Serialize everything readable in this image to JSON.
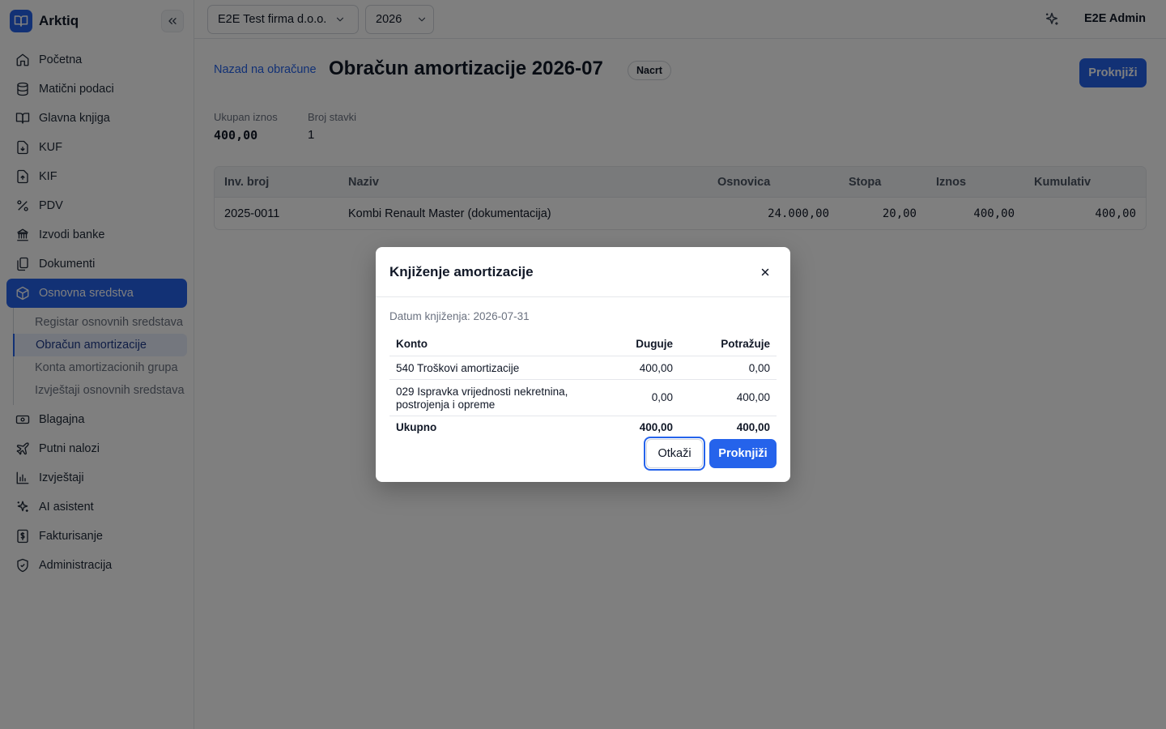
{
  "app": {
    "name": "Arktiq"
  },
  "sidebar": {
    "items": [
      {
        "label": "Početna",
        "icon": "home-icon"
      },
      {
        "label": "Matični podaci",
        "icon": "database-icon"
      },
      {
        "label": "Glavna knjiga",
        "icon": "book-icon"
      },
      {
        "label": "KUF",
        "icon": "file-download-icon"
      },
      {
        "label": "KIF",
        "icon": "file-upload-icon"
      },
      {
        "label": "PDV",
        "icon": "percent-icon"
      },
      {
        "label": "Izvodi banke",
        "icon": "bank-icon"
      },
      {
        "label": "Dokumenti",
        "icon": "documents-icon"
      },
      {
        "label": "Osnovna sredstva",
        "icon": "box-icon",
        "active": true
      }
    ],
    "subitems": [
      {
        "label": "Registar osnovnih sredstava"
      },
      {
        "label": "Obračun amortizacije",
        "active": true
      },
      {
        "label": "Konta amortizacionih grupa"
      },
      {
        "label": "Izvještaji osnovnih sredstava"
      }
    ],
    "items_after": [
      {
        "label": "Blagajna",
        "icon": "cash-icon"
      },
      {
        "label": "Putni nalozi",
        "icon": "plane-icon"
      },
      {
        "label": "Izvještaji",
        "icon": "bar-chart-icon"
      },
      {
        "label": "AI asistent",
        "icon": "sparkles-icon"
      },
      {
        "label": "Fakturisanje",
        "icon": "invoice-icon"
      },
      {
        "label": "Administracija",
        "icon": "shield-icon"
      }
    ]
  },
  "topbar": {
    "company": "E2E Test firma d.o.o.",
    "year": "2026",
    "user": "E2E Admin"
  },
  "page": {
    "back_link": "Nazad na obračune",
    "title": "Obračun amortizacije 2026-07",
    "status": "Nacrt",
    "post_button": "Proknjiži",
    "stats": {
      "total_label": "Ukupan iznos",
      "total_value": "400,00",
      "count_label": "Broj stavki",
      "count_value": "1"
    },
    "table": {
      "headers": [
        "Inv. broj",
        "Naziv",
        "Osnovica",
        "Stopa",
        "Iznos",
        "Kumulativ"
      ],
      "rows": [
        [
          "2025-0011",
          "Kombi Renault Master (dokumentacija)",
          "24.000,00",
          "20,00",
          "400,00",
          "400,00"
        ]
      ]
    }
  },
  "modal": {
    "title": "Knjiženje amortizacije",
    "date_line": "Datum knjiženja: 2026-07-31",
    "headers": [
      "Konto",
      "Duguje",
      "Potražuje"
    ],
    "rows": [
      [
        "540 Troškovi amortizacije",
        "400,00",
        "0,00"
      ],
      [
        "029 Ispravka vrijednosti nekretnina, postrojenja i opreme",
        "0,00",
        "400,00"
      ]
    ],
    "total": [
      "Ukupno",
      "400,00",
      "400,00"
    ],
    "cancel_label": "Otkaži",
    "post_label": "Proknjiži"
  },
  "colors": {
    "accent": "#2563eb",
    "overlay": "rgba(0,0,0,0.5)"
  }
}
